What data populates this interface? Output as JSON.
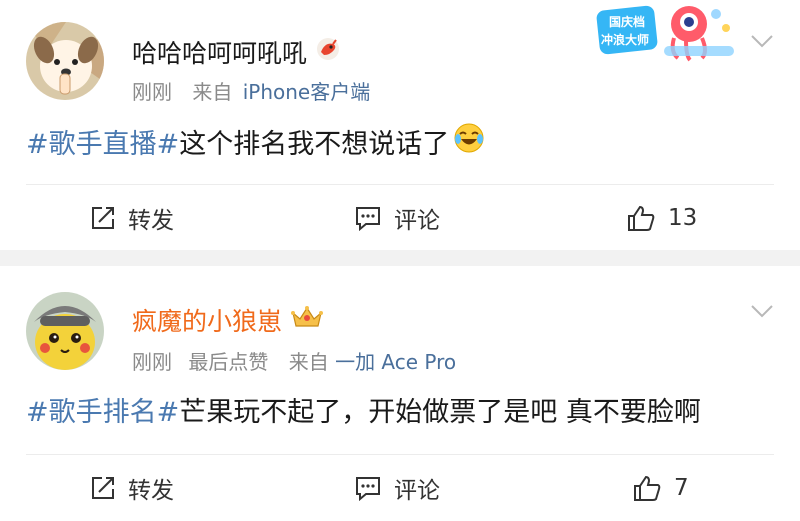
{
  "posts": [
    {
      "username": "哈哈哈呵呵吼吼",
      "time": "刚刚",
      "via_label": "来自",
      "source": "iPhone客户端",
      "hashtag": "#歌手直播#",
      "text": "这个排名我不想说话了",
      "badge_lines": [
        "国庆档",
        "冲浪大师"
      ],
      "actions": {
        "repost": "转发",
        "comment": "评论",
        "like_count": "13"
      }
    },
    {
      "username": "疯魔的小狼崽",
      "time": "刚刚",
      "extra": "最后点赞",
      "via_label": "来自",
      "source": "一加 Ace Pro",
      "hashtag": "#歌手排名#",
      "text": "芒果玩不起了，开始做票了是吧 真不要脸啊",
      "actions": {
        "repost": "转发",
        "comment": "评论",
        "like_count": "7"
      }
    }
  ],
  "colors": {
    "link": "#4a79b0",
    "orange_name": "#f06a1b",
    "meta": "#8a8a8a"
  },
  "icons": [
    "edit-repost-icon",
    "comment-icon",
    "thumbs-up-icon",
    "chevron-down-icon",
    "dragon-emoji-icon",
    "laugh-cry-emoji-icon",
    "crown-vip-icon"
  ]
}
